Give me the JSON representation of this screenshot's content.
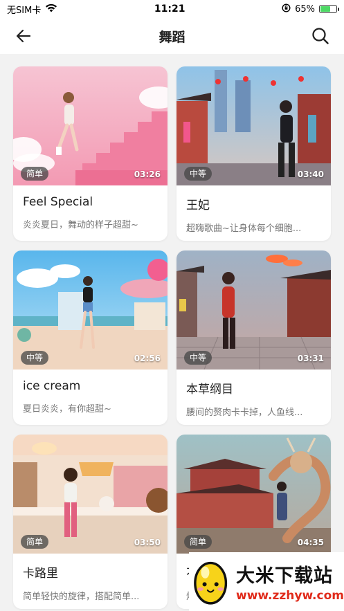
{
  "status_bar": {
    "carrier": "无SIM卡",
    "time": "11:21",
    "battery": "65%",
    "battery_level": 0.65
  },
  "header": {
    "title": "舞蹈"
  },
  "cards": [
    {
      "title": "Feel Special",
      "desc": "炎炎夏日，舞动的样子超甜~",
      "level": "简单",
      "duration": "03:26"
    },
    {
      "title": "王妃",
      "desc": "超嗨歌曲~让身体每个细胞...",
      "level": "中等",
      "duration": "03:40"
    },
    {
      "title": "ice cream",
      "desc": "夏日炎炎，有你超甜~",
      "level": "中等",
      "duration": "02:56"
    },
    {
      "title": "本草纲目",
      "desc": "腰间的赘肉卡卡掉，人鱼线...",
      "level": "中等",
      "duration": "03:31"
    },
    {
      "title": "卡路里",
      "desc": "简单轻快的旋律，搭配简单...",
      "level": "简单",
      "duration": "03:50"
    },
    {
      "title": "不",
      "desc": "炽",
      "level": "简单",
      "duration": "04:35"
    }
  ],
  "watermark": {
    "title": "大米下载站",
    "url": "www.zzhyw.com"
  }
}
